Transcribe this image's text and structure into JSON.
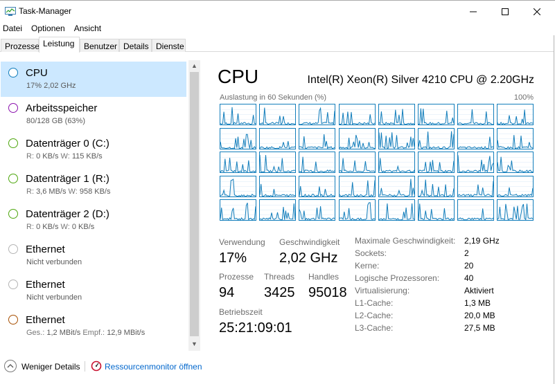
{
  "window": {
    "title": "Task-Manager"
  },
  "menu": [
    "Datei",
    "Optionen",
    "Ansicht"
  ],
  "tabs": [
    "Prozesse",
    "Leistung",
    "Benutzer",
    "Details",
    "Dienste"
  ],
  "active_tab": "Leistung",
  "sidebar": {
    "items": [
      {
        "name": "CPU",
        "sub": "17% 2,02 GHz",
        "color": "#117dbb",
        "selected": true
      },
      {
        "name": "Arbeitsspeicher",
        "sub": "80/128 GB (63%)",
        "color": "#8b12ae"
      },
      {
        "name": "Datenträger 0 (C:)",
        "sub_r_label": "R:",
        "sub_r": "0 KB/s",
        "sub_w_label": "W:",
        "sub_w": "115 KB/s",
        "color": "#4da60c"
      },
      {
        "name": "Datenträger 1 (R:)",
        "sub_r_label": "R:",
        "sub_r": "3,6 MB/s",
        "sub_w_label": "W:",
        "sub_w": "958 KB/s",
        "color": "#4da60c"
      },
      {
        "name": "Datenträger 2 (D:)",
        "sub_r_label": "R:",
        "sub_r": "0 KB/s",
        "sub_w_label": "W:",
        "sub_w": "0 KB/s",
        "color": "#4da60c"
      },
      {
        "name": "Ethernet",
        "sub": "Nicht verbunden",
        "color": "#b4b4b4"
      },
      {
        "name": "Ethernet",
        "sub": "Nicht verbunden",
        "color": "#b4b4b4"
      },
      {
        "name": "Ethernet",
        "sub_r_label": "Ges.:",
        "sub_r": "1,2 MBit/s",
        "sub_w_label": "Empf.:",
        "sub_w": "12,9 MBit/s",
        "color": "#a74f01"
      }
    ]
  },
  "main": {
    "title": "CPU",
    "model": "Intel(R) Xeon(R) Silver 4210 CPU @ 2.20GHz",
    "graph_label": "Auslastung in 60 Sekunden (%)",
    "graph_max": "100%",
    "graph_color": "#117dbb",
    "graph_cells": 40,
    "stats": {
      "usage_label": "Verwendung",
      "usage": "17%",
      "speed_label": "Geschwindigkeit",
      "speed": "2,02 GHz",
      "processes_label": "Prozesse",
      "processes": "94",
      "threads_label": "Threads",
      "threads": "3425",
      "handles_label": "Handles",
      "handles": "95018",
      "uptime_label": "Betriebszeit",
      "uptime": "25:21:09:01"
    },
    "info": [
      {
        "k": "Maximale Geschwindigkeit:",
        "v": "2,19 GHz"
      },
      {
        "k": "Sockets:",
        "v": "2"
      },
      {
        "k": "Kerne:",
        "v": "20"
      },
      {
        "k": "Logische Prozessoren:",
        "v": "40"
      },
      {
        "k": "Virtualisierung:",
        "v": "Aktiviert"
      },
      {
        "k": "L1-Cache:",
        "v": "1,3 MB"
      },
      {
        "k": "L2-Cache:",
        "v": "20,0 MB"
      },
      {
        "k": "L3-Cache:",
        "v": "27,5 MB"
      }
    ]
  },
  "footer": {
    "less": "Weniger Details",
    "resmon": "Ressourcenmonitor öffnen"
  }
}
